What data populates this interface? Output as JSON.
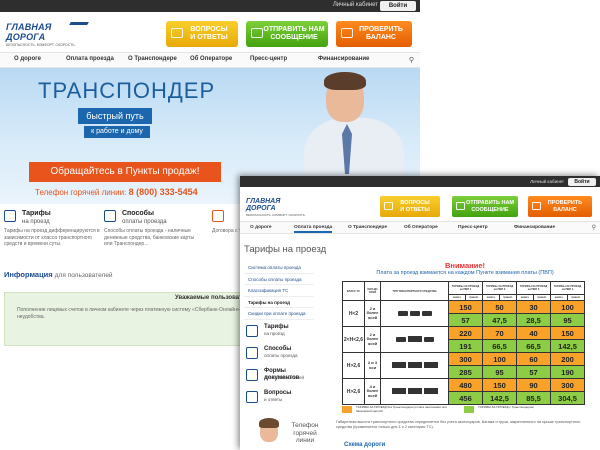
{
  "back": {
    "topbar": {
      "cabinet": "Личный кабинет",
      "login": "Войти"
    },
    "logo": {
      "name": "ГЛАВНАЯ ДОРОГА",
      "tagline": "БЕЗОПАСНОСТЬ. КОМФОРТ. СКОРОСТЬ."
    },
    "header_buttons": [
      {
        "line1": "ВОПРОСЫ",
        "line2": "И ОТВЕТЫ",
        "color": "#f3c21c"
      },
      {
        "line1": "ОТПРАВИТЬ НАМ",
        "line2": "СООБЩЕНИЕ",
        "color": "#55b41f"
      },
      {
        "line1": "ПРОВЕРИТЬ",
        "line2": "БАЛАНС",
        "color": "#f47515"
      }
    ],
    "nav": [
      "О дороге",
      "Оплата проезда",
      "О Транспондере",
      "Об Операторе",
      "Пресс-центр",
      "Финансирование"
    ],
    "hero": {
      "title": "ТРАНСПОНДЕР",
      "pill1": "быстрый путь",
      "pill2": "к работе и дому",
      "cta": "Обращайтесь в Пункты продаж!",
      "hotline_label": "Телефон горячей линии:",
      "hotline_number": "8 (800) 333-5454"
    },
    "services": [
      {
        "title": "Тарифы",
        "sub": "на проезд",
        "text": "Тарифы на проезд дифференцируются в зависимости от класса транспортного средств и времени суты."
      },
      {
        "title": "Способы",
        "sub": "оплаты проезда",
        "text": "Способы оплаты проезда - наличные денежные средства, банковские карты или Транспондер..."
      },
      {
        "title": "",
        "sub": "",
        "text": "Договора с транспо..."
      }
    ],
    "info": {
      "title": "Информация",
      "sub": "для пользователей"
    },
    "notice": {
      "title": "Уважаемые пользовател",
      "text": "Пополнение лицевых счетов в личном кабинете через платежную систему «Сбербанк-Онлайн» времен дополнительно. Приносим извинения за доставленные неудобства."
    }
  },
  "front": {
    "topbar": {
      "cabinet": "Личный кабинет",
      "login": "Войти"
    },
    "logo": {
      "name": "ГЛАВНАЯ ДОРОГА",
      "tagline": "БЕЗОПАСНОСТЬ. КОМФОРТ. СКОРОСТЬ."
    },
    "header_buttons": [
      {
        "line1": "ВОПРОСЫ",
        "line2": "И ОТВЕТЫ"
      },
      {
        "line1": "ОТПРАВИТЬ НАМ",
        "line2": "СООБЩЕНИЕ"
      },
      {
        "line1": "ПРОВЕРИТЬ",
        "line2": "БАЛАНС"
      }
    ],
    "nav": [
      "О дороге",
      "Оплата проезда",
      "О Транспондере",
      "Об Операторе",
      "Пресс-центр",
      "Финансирование"
    ],
    "page_title": "Тарифы на проезд",
    "sidebar_links": [
      "Система оплаты проезда",
      "Способы оплаты проезда",
      "Классификация ТС",
      "Тарифы на проезд",
      "Скидки при оплате проезда"
    ],
    "sidebar_icons": [
      {
        "title": "Тарифы",
        "sub": "на проезд"
      },
      {
        "title": "Способы",
        "sub": "оплаты проезда"
      },
      {
        "title": "Формы документов",
        "sub": "для пользователей"
      },
      {
        "title": "Вопросы",
        "sub": "и ответы"
      }
    ],
    "hotline": "Телефон горячей линии",
    "warning": "Внимание!",
    "warning_sub": "Плата за проезд взимается на каждом Пункте взимания платы (ПВП)",
    "table": {
      "head": [
        "КЛАСС ТС",
        "КОЛ-ВО ОСЕЙ",
        "ТИП ТРАНСПОРТНОГО СРЕДСТВА",
        "ТАРИФЫ ЗА ПРОЕЗД на ПВП 1",
        "ТАРИФЫ ЗА ПРОЕЗД на ПВП 2",
        "ТАРИФЫ ЗА ПРОЕЗД на ПВП 3",
        "ТАРИФЫ ЗА ПРОЕЗД на ПВП 4"
      ],
      "sub": [
        "налич.",
        "трансп.",
        "налич.",
        "трансп.",
        "налич.",
        "трансп.",
        "налич.",
        "трансп."
      ],
      "rows": [
        {
          "cls": "H<2",
          "axles": "2 и более осей",
          "vals": [
            "150",
            "50",
            "30",
            "100"
          ]
        },
        {
          "cls": "",
          "axles": "",
          "vals": [
            "57",
            "47,5",
            "28,5",
            "95"
          ]
        },
        {
          "cls": "2<H<2,6",
          "axles": "2 и более осей",
          "vals": [
            "220",
            "70",
            "40",
            "150"
          ]
        },
        {
          "cls": "",
          "axles": "",
          "vals": [
            "191",
            "66,5",
            "66,5",
            "142,5"
          ]
        },
        {
          "cls": "H>2,6",
          "axles": "2 и 3 оси",
          "vals": [
            "300",
            "100",
            "60",
            "200"
          ]
        },
        {
          "cls": "",
          "axles": "",
          "vals": [
            "285",
            "95",
            "57",
            "190"
          ]
        },
        {
          "cls": "H>2,6",
          "axles": "4 и более осей",
          "vals": [
            "480",
            "150",
            "90",
            "300"
          ]
        },
        {
          "cls": "",
          "axles": "",
          "vals": [
            "456",
            "142,5",
            "85,5",
            "304,5"
          ]
        }
      ]
    },
    "legend": [
      {
        "text": "ТАРИФЫ ЗА ПРОЕЗД без Транспондера (оплата наличными или банковской картой)",
        "color": "#f8a22a"
      },
      {
        "text": "ТАРИФЫ ЗА ПРОЕЗД с Транспондером",
        "color": "#8ccd45"
      }
    ],
    "footnote": "Габаритная высота транспортного средства определяется без учета аксессуаров. Багажа и груза, закрепленного на крыше транспортного средства (применяется только для 1 и 2 категории ТС).",
    "scheme": "Схема дороги"
  }
}
